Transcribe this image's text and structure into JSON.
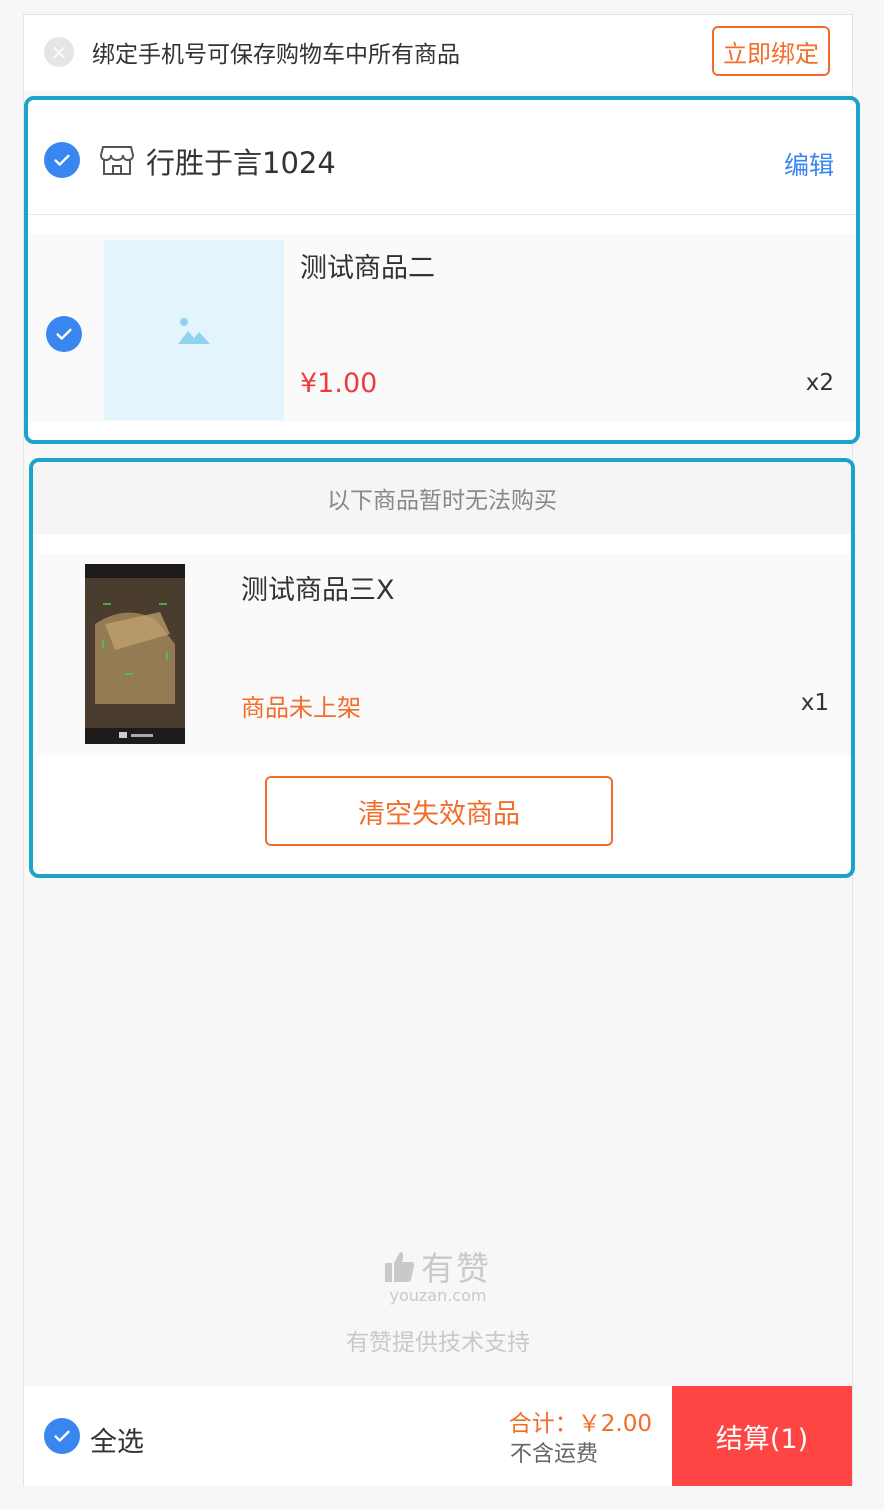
{
  "bind_bar": {
    "message": "绑定手机号可保存购物车中所有商品",
    "button_label": "立即绑定"
  },
  "shop": {
    "name": "行胜于言1024",
    "edit_label": "编辑",
    "items": [
      {
        "title": "测试商品二",
        "price": "¥1.00",
        "qty": "x2"
      }
    ]
  },
  "invalid": {
    "header": "以下商品暂时无法购买",
    "items": [
      {
        "title": "测试商品三X",
        "status": "商品未上架",
        "qty": "x1"
      }
    ],
    "clear_label": "清空失效商品"
  },
  "brand": {
    "name": "有赞",
    "domain": "youzan.com",
    "support": "有赞提供技术支持"
  },
  "footer": {
    "select_all_label": "全选",
    "total": "合计：￥2.00",
    "freight_note": "不含运费",
    "checkout_label": "结算(1)"
  },
  "colors": {
    "accent_blue": "#3a86f0",
    "orange": "#f36d2a",
    "price_red": "#ee3c3c",
    "checkout_red": "#ff4444"
  }
}
